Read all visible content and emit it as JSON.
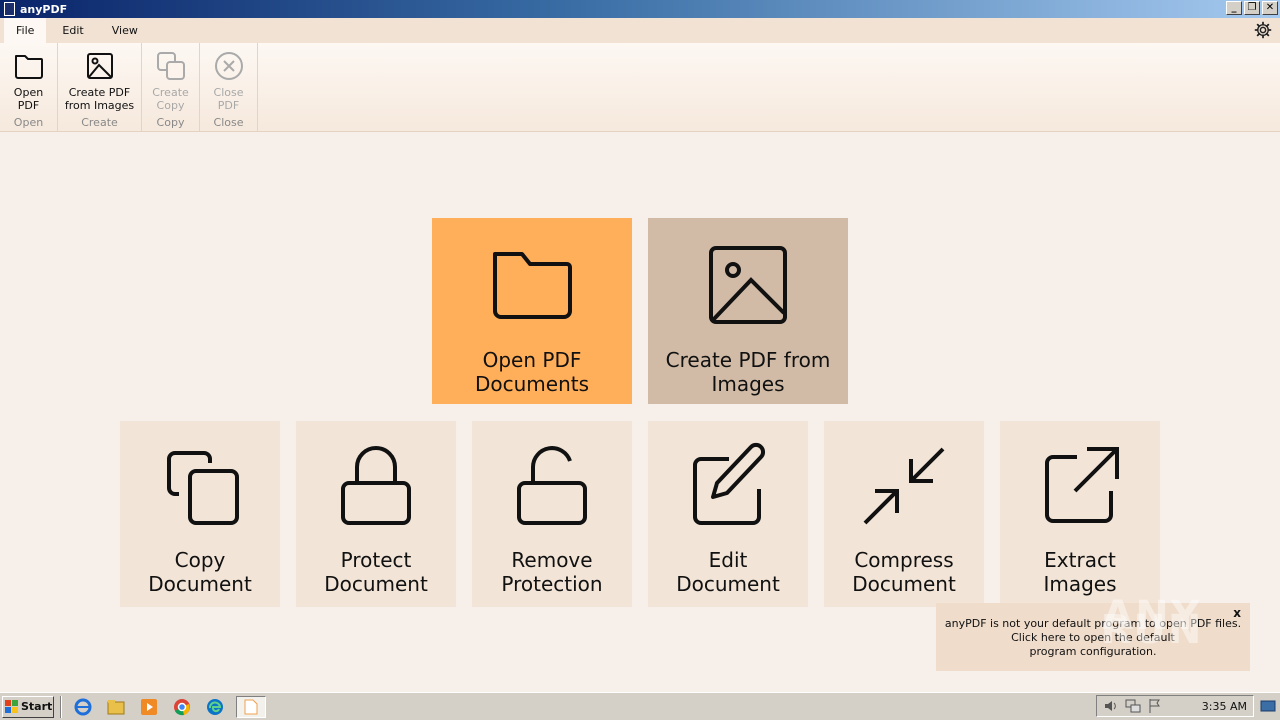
{
  "window": {
    "title": "anyPDF",
    "controls": {
      "minimize": "_",
      "restore": "❐",
      "close": "✕"
    }
  },
  "menu": {
    "tabs": [
      "File",
      "Edit",
      "View"
    ],
    "active": "File"
  },
  "ribbon": {
    "groups": [
      {
        "label": "Open\nPDF",
        "group": "Open",
        "icon": "folder-icon",
        "enabled": true
      },
      {
        "label": "Create PDF\nfrom Images",
        "group": "Create",
        "icon": "image-icon",
        "enabled": true
      },
      {
        "label": "Create\nCopy",
        "group": "Copy",
        "icon": "copy-icon",
        "enabled": false
      },
      {
        "label": "Close\nPDF",
        "group": "Close",
        "icon": "close-circle-icon",
        "enabled": false
      }
    ]
  },
  "tiles": {
    "open_pdf": "Open PDF Documents",
    "create_pdf": "Create PDF from Images",
    "copy": "Copy Document",
    "protect": "Protect Document",
    "remove_protection": "Remove Protection",
    "edit": "Edit Document",
    "compress": "Compress Document",
    "extract": "Extract Images"
  },
  "colors": {
    "open_tile": "#ffae5a",
    "create_tile": "#d1bba6",
    "small_tile": "#f2e4d7",
    "background": "#f6efea"
  },
  "notification": {
    "line1": "anyPDF is not your default program to open PDF files.",
    "line2": "Click here to open the default",
    "line3": "program configuration.",
    "close": "x"
  },
  "taskbar": {
    "start": "Start",
    "clock": "3:35 AM"
  }
}
